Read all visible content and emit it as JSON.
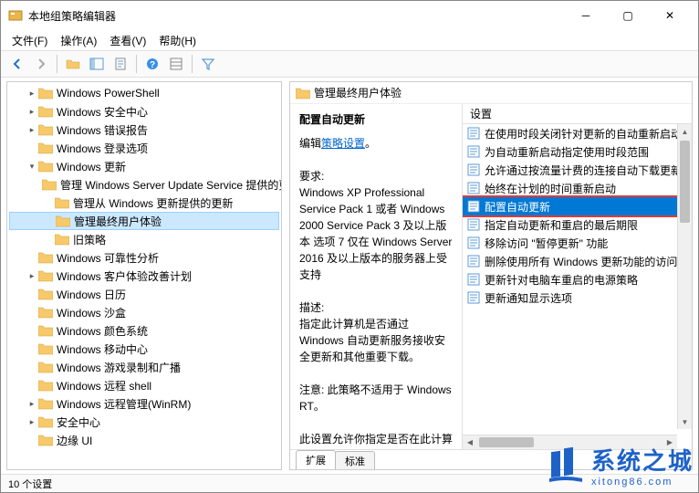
{
  "window": {
    "title": "本地组策略编辑器"
  },
  "menu": {
    "file": "文件(F)",
    "action": "操作(A)",
    "view": "查看(V)",
    "help": "帮助(H)"
  },
  "tree": [
    {
      "indent": 1,
      "label": "Windows PowerShell",
      "caret": ">"
    },
    {
      "indent": 1,
      "label": "Windows 安全中心",
      "caret": ">"
    },
    {
      "indent": 1,
      "label": "Windows 错误报告",
      "caret": ">"
    },
    {
      "indent": 1,
      "label": "Windows 登录选项",
      "caret": ""
    },
    {
      "indent": 1,
      "label": "Windows 更新",
      "caret": "v"
    },
    {
      "indent": 2,
      "label": "管理 Windows Server Update Service 提供的更新",
      "caret": ""
    },
    {
      "indent": 2,
      "label": "管理从 Windows 更新提供的更新",
      "caret": ""
    },
    {
      "indent": 2,
      "label": "管理最终用户体验",
      "caret": "",
      "sel": true
    },
    {
      "indent": 2,
      "label": "旧策略",
      "caret": ""
    },
    {
      "indent": 1,
      "label": "Windows 可靠性分析",
      "caret": ""
    },
    {
      "indent": 1,
      "label": "Windows 客户体验改善计划",
      "caret": ">"
    },
    {
      "indent": 1,
      "label": "Windows 日历",
      "caret": ""
    },
    {
      "indent": 1,
      "label": "Windows 沙盒",
      "caret": ""
    },
    {
      "indent": 1,
      "label": "Windows 颜色系统",
      "caret": ""
    },
    {
      "indent": 1,
      "label": "Windows 移动中心",
      "caret": ""
    },
    {
      "indent": 1,
      "label": "Windows 游戏录制和广播",
      "caret": ""
    },
    {
      "indent": 1,
      "label": "Windows 远程 shell",
      "caret": ""
    },
    {
      "indent": 1,
      "label": "Windows 远程管理(WinRM)",
      "caret": ">"
    },
    {
      "indent": 1,
      "label": "安全中心",
      "caret": ">"
    },
    {
      "indent": 1,
      "label": "边缘 UI",
      "caret": ""
    }
  ],
  "right": {
    "header": "管理最终用户体验",
    "desc_title": "配置自动更新",
    "edit_link_prefix": "编辑",
    "edit_link": "策略设置",
    "req_label": "要求:",
    "req_body": "Windows XP Professional Service Pack 1 或者 Windows 2000 Service Pack 3 及以上版本 选项 7 仅在 Windows Server 2016 及以上版本的服务器上受支持",
    "desc_label": "描述:",
    "desc_body": "指定此计算机是否通过 Windows 自动更新服务接收安全更新和其他重要下载。",
    "note": "注意: 此策略不适用于 Windows RT。",
    "more": "此设置允许你指定是否在此计算机上启用自动更新。如果启用该服务，则必须在组策略设置中选择以下四个选项之一:"
  },
  "list": {
    "header": "设置",
    "items": [
      {
        "label": "在使用时段关闭针对更新的自动重新启动",
        "active": false
      },
      {
        "label": "为自动重新启动指定使用时段范围",
        "active": false
      },
      {
        "label": "允许通过按流量计费的连接自动下载更新",
        "active": false
      },
      {
        "label": "始终在计划的时间重新启动",
        "active": false
      },
      {
        "label": "配置自动更新",
        "active": true
      },
      {
        "label": "指定自动更新和重启的最后期限",
        "active": false
      },
      {
        "label": "移除访问 \"暂停更新\" 功能",
        "active": false
      },
      {
        "label": "删除使用所有 Windows 更新功能的访问权限",
        "active": false
      },
      {
        "label": "更新针对电脑车重启的电源策略",
        "active": false
      },
      {
        "label": "更新通知显示选项",
        "active": false
      }
    ]
  },
  "tabs": {
    "extended": "扩展",
    "standard": "标准"
  },
  "status": "10 个设置",
  "watermark": {
    "cn": "系统之城",
    "en": "xitong86.com"
  }
}
